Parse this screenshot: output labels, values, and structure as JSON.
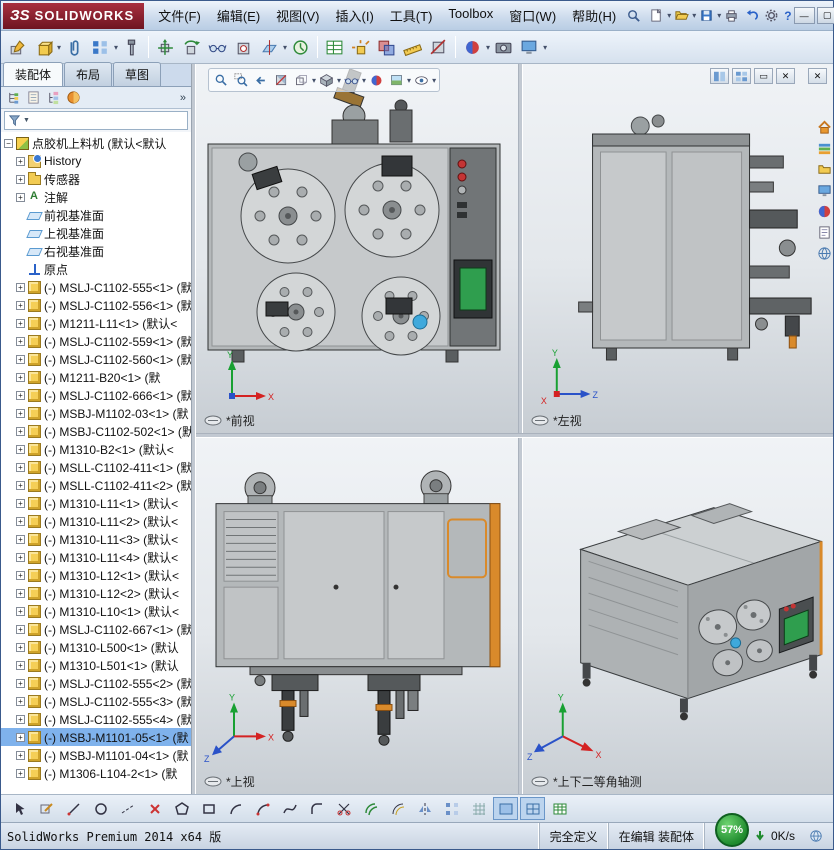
{
  "titlebar": {
    "logo_mark": "ЗS",
    "logo_text": "SOLIDWORKS",
    "menus": [
      "文件(F)",
      "编辑(E)",
      "视图(V)",
      "插入(I)",
      "工具(T)",
      "Toolbox",
      "窗口(W)",
      "帮助(H)"
    ]
  },
  "icons": {
    "caret": "▾",
    "filter_caret": "▼",
    "chevrons": "»",
    "minimize": "—",
    "maximize": "▢",
    "restore": "▭",
    "close": "✕",
    "question": "?",
    "warning": "⚠"
  },
  "axes": {
    "x": "X",
    "y": "Y",
    "z": "Z"
  },
  "left_panel": {
    "tabs": [
      {
        "label": "装配体",
        "active": true
      },
      {
        "label": "布局"
      },
      {
        "label": "草图"
      }
    ],
    "tree_items": [
      {
        "label": "点胶机上料机 (默认<默认",
        "type": "assembly",
        "warning": true,
        "expander": "−",
        "depth": 0
      },
      {
        "label": "History",
        "type": "history",
        "expander": "+",
        "depth": 1
      },
      {
        "label": "传感器",
        "type": "folder",
        "expander": "+",
        "depth": 1
      },
      {
        "label": "注解",
        "type": "annotation",
        "expander": "+",
        "depth": 1
      },
      {
        "label": "前视基准面",
        "type": "plane",
        "depth": 1
      },
      {
        "label": "上视基准面",
        "type": "plane",
        "depth": 1
      },
      {
        "label": "右视基准面",
        "type": "plane",
        "depth": 1
      },
      {
        "label": "原点",
        "type": "origin",
        "depth": 1
      },
      {
        "label": "(-) MSLJ-C1102-555<1> (默",
        "type": "part",
        "expander": "+",
        "depth": 1
      },
      {
        "label": "(-) MSLJ-C1102-556<1> (默",
        "type": "part",
        "expander": "+",
        "depth": 1
      },
      {
        "label": "(-) M1211-L11<1> (默认<",
        "type": "part",
        "expander": "+",
        "depth": 1
      },
      {
        "label": "(-) MSLJ-C1102-559<1> (默",
        "type": "part",
        "expander": "+",
        "depth": 1
      },
      {
        "label": "(-) MSLJ-C1102-560<1> (默",
        "type": "part",
        "expander": "+",
        "depth": 1
      },
      {
        "label": "(-) M1211-B20<1> (默",
        "type": "part",
        "warning": true,
        "expander": "+",
        "depth": 1
      },
      {
        "label": "(-) MSLJ-C1102-666<1> (默",
        "type": "part",
        "expander": "+",
        "depth": 1
      },
      {
        "label": "(-) MSBJ-M1102-03<1> (默",
        "type": "part",
        "warning": true,
        "expander": "+",
        "depth": 1
      },
      {
        "label": "(-) MSBJ-C1102-502<1> (默",
        "type": "part",
        "warning": true,
        "expander": "+",
        "depth": 1
      },
      {
        "label": "(-) M1310-B2<1> (默认<",
        "type": "part",
        "warning": true,
        "expander": "+",
        "depth": 1
      },
      {
        "label": "(-) MSLL-C1102-411<1> (默",
        "type": "part",
        "expander": "+",
        "depth": 1
      },
      {
        "label": "(-) MSLL-C1102-411<2> (默",
        "type": "part",
        "expander": "+",
        "depth": 1
      },
      {
        "label": "(-) M1310-L11<1> (默认<",
        "type": "part",
        "expander": "+",
        "depth": 1
      },
      {
        "label": "(-) M1310-L11<2> (默认<",
        "type": "part",
        "expander": "+",
        "depth": 1
      },
      {
        "label": "(-) M1310-L11<3> (默认<",
        "type": "part",
        "expander": "+",
        "depth": 1
      },
      {
        "label": "(-) M1310-L11<4> (默认<",
        "type": "part",
        "expander": "+",
        "depth": 1
      },
      {
        "label": "(-) M1310-L12<1> (默认<",
        "type": "part",
        "expander": "+",
        "depth": 1
      },
      {
        "label": "(-) M1310-L12<2> (默认<",
        "type": "part",
        "expander": "+",
        "depth": 1
      },
      {
        "label": "(-) M1310-L10<1> (默认<",
        "type": "part",
        "expander": "+",
        "depth": 1
      },
      {
        "label": "(-) MSLJ-C1102-667<1> (默",
        "type": "part",
        "expander": "+",
        "depth": 1
      },
      {
        "label": "(-) M1310-L500<1> (默认",
        "type": "part",
        "expander": "+",
        "depth": 1
      },
      {
        "label": "(-) M1310-L501<1> (默认",
        "type": "part",
        "expander": "+",
        "depth": 1
      },
      {
        "label": "(-) MSLJ-C1102-555<2> (默",
        "type": "part",
        "expander": "+",
        "depth": 1
      },
      {
        "label": "(-) MSLJ-C1102-555<3> (默",
        "type": "part",
        "expander": "+",
        "depth": 1
      },
      {
        "label": "(-) MSLJ-C1102-555<4> (默",
        "type": "part",
        "expander": "+",
        "depth": 1
      },
      {
        "label": "(-) MSBJ-M1101-05<1> (默",
        "type": "part",
        "warning": true,
        "selected": true,
        "expander": "+",
        "depth": 1
      },
      {
        "label": "(-) MSBJ-M1101-04<1> (默",
        "type": "part",
        "expander": "+",
        "depth": 1
      },
      {
        "label": "(-) M1306-L104-2<1> (默",
        "type": "part",
        "warning": true,
        "expander": "+",
        "depth": 1
      }
    ]
  },
  "viewports": {
    "front": {
      "label": "*前视"
    },
    "left": {
      "label": "*左视"
    },
    "top": {
      "label": "*上视"
    },
    "iso": {
      "label": "*上下二等角轴测"
    }
  },
  "statusbar": {
    "product": "SolidWorks Premium 2014 x64 版",
    "define_state": "完全定义",
    "editing": "在编辑 装配体",
    "progress_percent": "57%",
    "net_speed": "0K/s"
  },
  "colors": {
    "accent_orange": "#d98a2b",
    "screen_green": "#2f9e4e",
    "warning_yellow": "#cf9a10",
    "selection_blue": "#7fb2ec",
    "logo_red": "#8a1c28"
  }
}
